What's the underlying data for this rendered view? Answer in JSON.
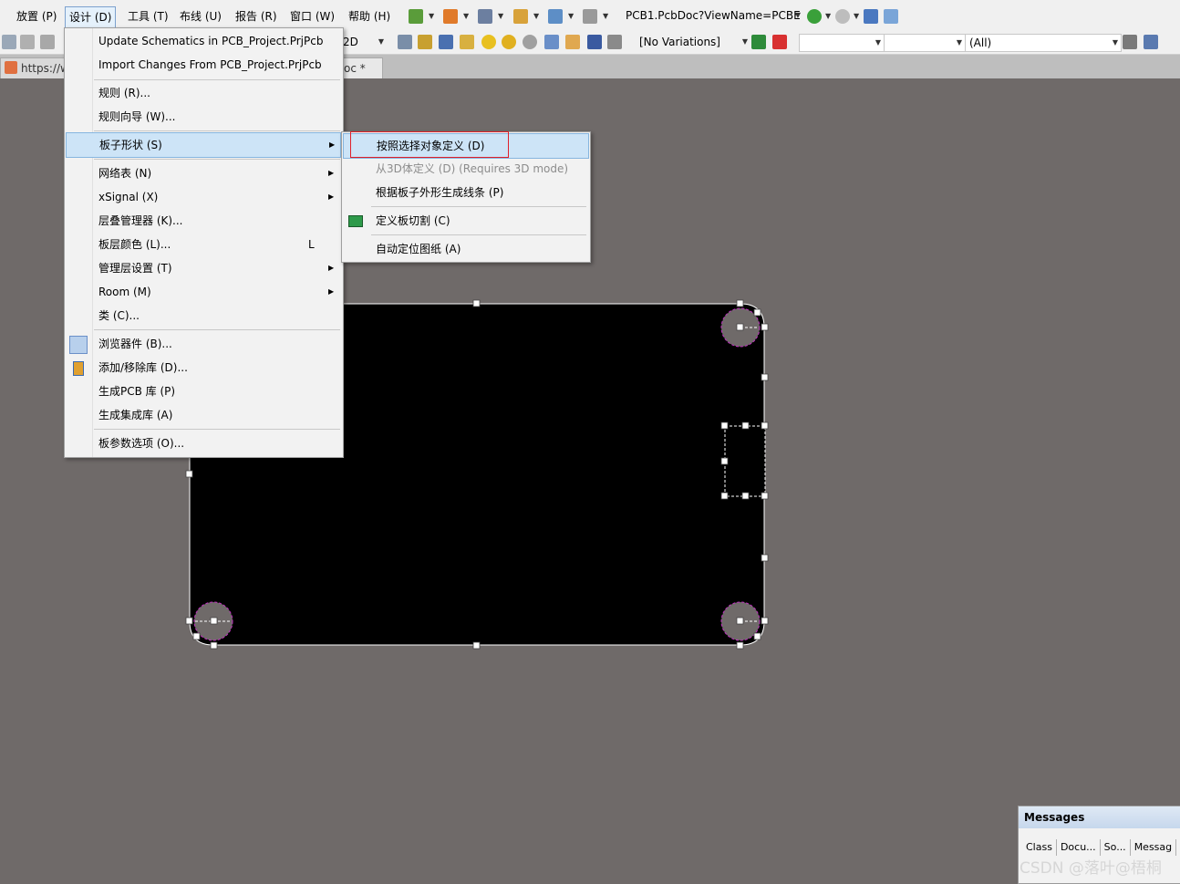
{
  "menubar": {
    "items": [
      "放置 (P)",
      "设计 (D)",
      "工具 (T)",
      "布线 (U)",
      "报告 (R)",
      "窗口 (W)",
      "帮助 (H)"
    ]
  },
  "toolbar": {
    "view_path": "PCB1.PcbDoc?ViewName=PCBE",
    "view_mode": "2D",
    "variations": "[No Variations]",
    "filter_all": "(All)"
  },
  "tabs": {
    "home_url": "https://w",
    "doc_tab": "oc *"
  },
  "design_menu": {
    "items": [
      {
        "label": "Update Schematics in PCB_Project.PrjPcb",
        "shortcut": "",
        "submenu": false
      },
      {
        "label": "Import Changes From PCB_Project.PrjPcb",
        "shortcut": "",
        "submenu": false
      },
      {
        "label": "规则 (R)...",
        "shortcut": "",
        "submenu": false
      },
      {
        "label": "规则向导 (W)...",
        "shortcut": "",
        "submenu": false
      },
      {
        "label": "板子形状 (S)",
        "shortcut": "",
        "submenu": true
      },
      {
        "label": "网络表 (N)",
        "shortcut": "",
        "submenu": true
      },
      {
        "label": "xSignal (X)",
        "shortcut": "",
        "submenu": true
      },
      {
        "label": "层叠管理器 (K)...",
        "shortcut": "",
        "submenu": false
      },
      {
        "label": "板层颜色 (L)...",
        "shortcut": "L",
        "submenu": false
      },
      {
        "label": "管理层设置 (T)",
        "shortcut": "",
        "submenu": true
      },
      {
        "label": "Room (M)",
        "shortcut": "",
        "submenu": true
      },
      {
        "label": "类 (C)...",
        "shortcut": "",
        "submenu": false
      },
      {
        "label": "浏览器件 (B)...",
        "shortcut": "",
        "submenu": false
      },
      {
        "label": "添加/移除库 (D)...",
        "shortcut": "",
        "submenu": false
      },
      {
        "label": "生成PCB 库 (P)",
        "shortcut": "",
        "submenu": false
      },
      {
        "label": "生成集成库 (A)",
        "shortcut": "",
        "submenu": false
      },
      {
        "label": "板参数选项 (O)...",
        "shortcut": "",
        "submenu": false
      }
    ]
  },
  "shape_submenu": {
    "items": [
      {
        "label": "按照选择对象定义 (D)"
      },
      {
        "label": "从3D体定义 (D) (Requires 3D mode)"
      },
      {
        "label": "根据板子外形生成线条 (P)"
      },
      {
        "label": "定义板切割 (C)"
      },
      {
        "label": "自动定位图纸 (A)"
      }
    ]
  },
  "messages": {
    "title": "Messages",
    "columns": [
      "Class",
      "Docu...",
      "So...",
      "Messag"
    ]
  },
  "watermark": "CSDN @落叶@梧桐",
  "colors": {
    "canvas": "#6f6a69",
    "board": "#000000",
    "highlight": "#cde4f7",
    "red_box": "#e0202a",
    "hole_outline": "#c030c0"
  }
}
